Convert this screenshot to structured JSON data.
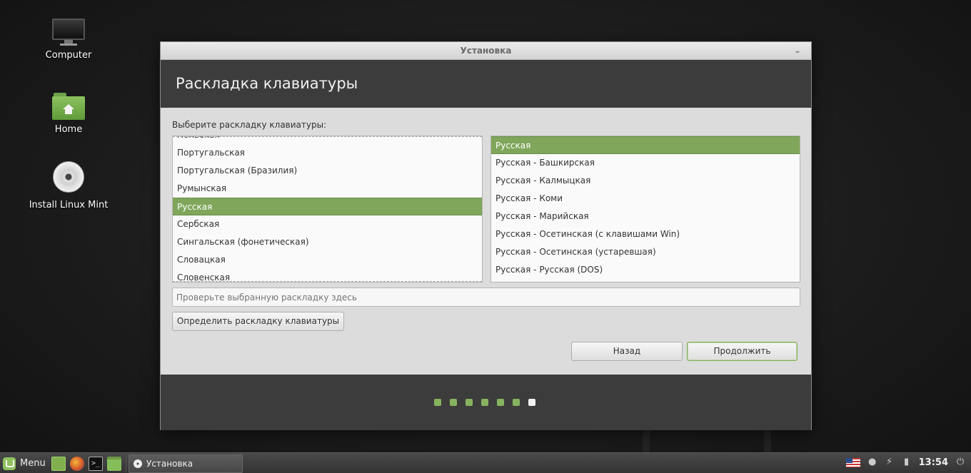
{
  "desktop": {
    "icons": [
      {
        "label": "Computer"
      },
      {
        "label": "Home"
      },
      {
        "label": "Install Linux Mint"
      }
    ]
  },
  "window": {
    "title": "Установка",
    "heading": "Раскладка клавиатуры",
    "choose_label": "Выберите раскладку клавиатуры:",
    "layouts": [
      "Польская",
      "Португальская",
      "Португальская (Бразилия)",
      "Румынская",
      "Русская",
      "Сербская",
      "Сингальская (фонетическая)",
      "Словацкая",
      "Словенская"
    ],
    "selected_layout": "Русская",
    "variants": [
      "Русская",
      "Русская - Башкирская",
      "Русская - Калмыцкая",
      "Русская - Коми",
      "Русская - Марийская",
      "Русская - Осетинская (с клавишами Win)",
      "Русская - Осетинская (устаревшая)",
      "Русская - Русская (DOS)"
    ],
    "selected_variant": "Русская",
    "test_placeholder": "Проверьте выбранную раскладку здесь",
    "detect_button": "Определить раскладку клавиатуры",
    "back_button": "Назад",
    "continue_button": "Продолжить",
    "progress": {
      "total_steps": 7,
      "current_step": 7
    }
  },
  "taskbar": {
    "menu_label": "Menu",
    "task_label": "Установка",
    "clock": "13:54",
    "keyboard_flag": "us-flag-icon"
  },
  "colors": {
    "accent": "#7fa65a",
    "header_band": "#3c3c3c",
    "window_bg": "#dcdcdc"
  }
}
